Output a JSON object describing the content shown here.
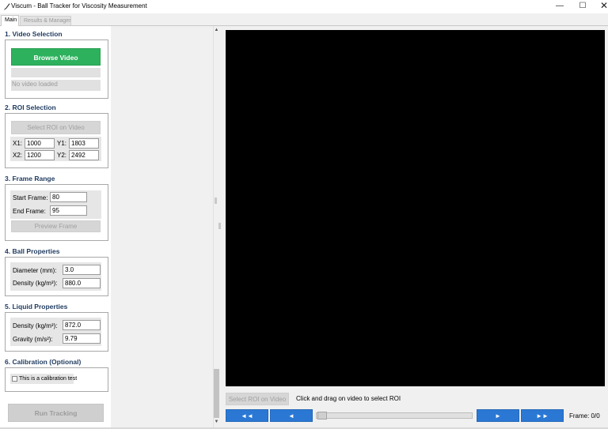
{
  "window": {
    "title": "Viscum - Ball Tracker for Viscosity Measurement",
    "min_symbol": "—",
    "max_symbol": "☐",
    "close_symbol": "✕",
    "app_icon": "feather-icon"
  },
  "tabs": [
    {
      "label": "Main",
      "active": true
    },
    {
      "label": "Results & Manager",
      "active": false
    }
  ],
  "video_selection": {
    "title": "1. Video Selection",
    "browse_label": "Browse Video",
    "status": "No video loaded",
    "browse_color": "#2db15d"
  },
  "roi_selection": {
    "title": "2. ROI Selection",
    "select_label": "Select ROI on Video",
    "x1_label": "X1:",
    "x1": "1000",
    "y1_label": "Y1:",
    "y1": "1803",
    "x2_label": "X2:",
    "x2": "1200",
    "y2_label": "Y2:",
    "y2": "2492"
  },
  "frame_range": {
    "title": "3. Frame Range",
    "start_label": "Start Frame:",
    "start": "80",
    "end_label": "End Frame:",
    "end": "95",
    "preview_label": "Preview Frame"
  },
  "ball_properties": {
    "title": "4. Ball Properties",
    "diameter_label": "Diameter (mm):",
    "diameter": "3.0",
    "density_label": "Density (kg/m³):",
    "density": "880.0"
  },
  "liquid_properties": {
    "title": "5. Liquid Properties",
    "density_label": "Density (kg/m³):",
    "density": "872.0",
    "gravity_label": "Gravity (m/s²):",
    "gravity": "9.79"
  },
  "calibration": {
    "title": "6. Calibration (Optional)",
    "checkbox_label": "This is a calibration test",
    "checked": false
  },
  "run_label": "Run Tracking",
  "video_panel": {
    "select_roi_label": "Select ROI on Video",
    "hint": "Click and drag on video to select ROI",
    "first_label": "◄◄",
    "prev_label": "◄",
    "next_label": "►",
    "last_label": "►►",
    "frame_text": "Frame: 0/0",
    "nav_color": "#2b78d4",
    "slider_position": 0
  }
}
